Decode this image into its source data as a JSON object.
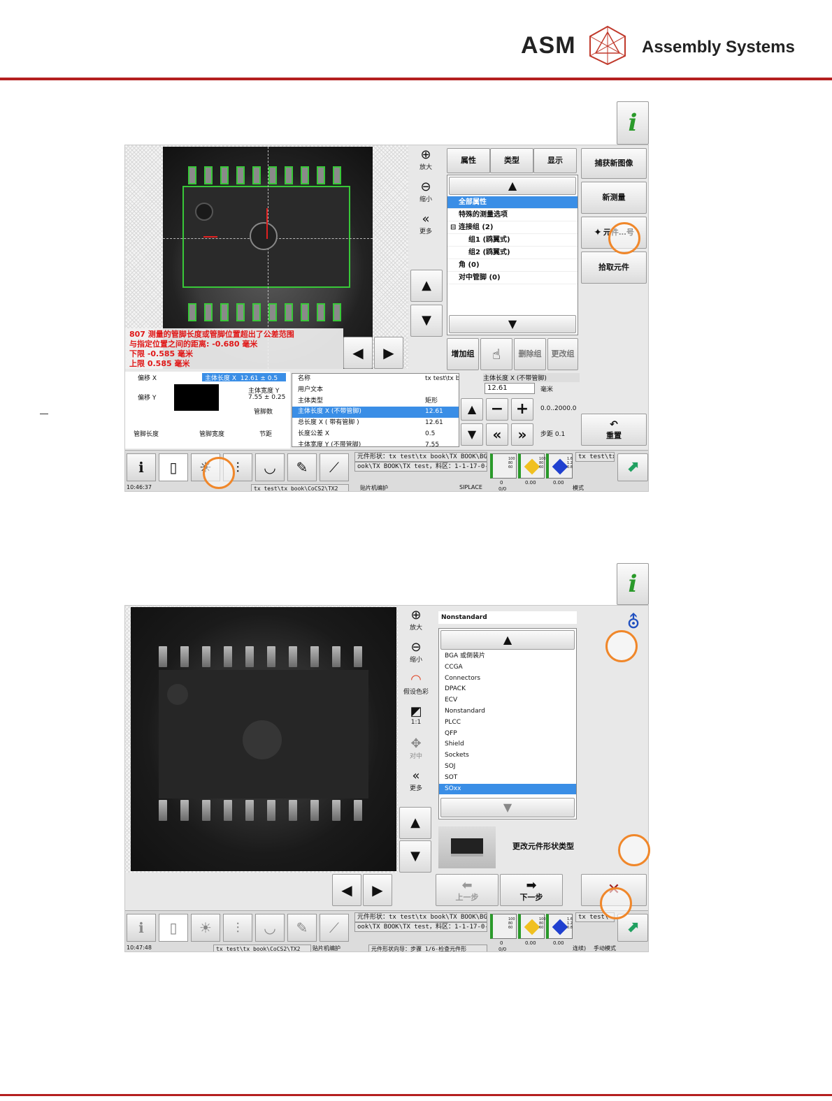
{
  "header": {
    "brand": "ASM",
    "brand_sub": "Assembly Systems"
  },
  "screen1": {
    "view_tools": {
      "zoom_in": "放大",
      "zoom_out": "缩小",
      "more": "更多"
    },
    "tabs": [
      "属性",
      "类型",
      "显示"
    ],
    "props_tree": [
      {
        "label": "全部属性",
        "selected": true
      },
      {
        "label": "特殊的测量选项"
      },
      {
        "label": "连接组 (2)",
        "toggle": "⊟"
      },
      {
        "label": "组1 (鸥翼式)",
        "indent": true
      },
      {
        "label": "组2 (鸥翼式)",
        "indent": true
      },
      {
        "label": "角 (0)"
      },
      {
        "label": "对中管脚 (0)"
      }
    ],
    "side_buttons": {
      "capture": "捕获新图像",
      "new_measure": "新测量",
      "component": "元件…号",
      "pick": "拾取元件"
    },
    "group_buttons": {
      "add": "增加组",
      "delete": "删除组",
      "change": "更改组"
    },
    "error": {
      "line1": "807 测量的管脚长度或管脚位置超出了公差范围",
      "line2": "与指定位置之间的距离: -0.680 毫米",
      "line3": "下限 -0.585 毫米",
      "line4": "上限 0.585 毫米"
    },
    "diagram": {
      "offset_x": "偏移 X",
      "offset_y": "偏移 Y",
      "body_len_x": "主体长度 X",
      "body_len_x_val": "12.61 ± 0.5",
      "body_w_y": "主体宽度 Y",
      "body_w_y_val": "7.55 ± 0.25",
      "pin_count": "管脚数",
      "pin_len": "管脚长度",
      "pin_width": "管脚宽度",
      "pitch": "节距"
    },
    "prop_table": [
      {
        "name": "名称",
        "value": "tx test\\tx b"
      },
      {
        "name": "用户文本",
        "value": ""
      },
      {
        "name": "主体类型",
        "value": "矩形"
      },
      {
        "name": "主体长度 X (不带管脚)",
        "value": "12.61",
        "selected": true
      },
      {
        "name": "总长度 X ( 带有管脚 )",
        "value": "12.61"
      },
      {
        "name": "长度公差 X",
        "value": "0.5"
      },
      {
        "name": "主体宽度 Y (不带管脚)",
        "value": "7.55"
      }
    ],
    "editor": {
      "title": "主体长度 X (不带管脚)",
      "value": "12.61",
      "unit": "毫米",
      "range": "0.0..2000.0",
      "step": "步距 0.1",
      "reset": "重置"
    },
    "status_msg1": "元件形状：tx test\\tx book\\TX BOOK\\BGA",
    "status_msg2": "ook\\TX BOOK\\TX test，料区：1-1-17-0-1",
    "status_right": "tx test\\tx b",
    "clock": "10:46:37",
    "path": "tx test\\tx book\\CoCS2\\TX2",
    "machine": "贴片机编护",
    "siplace": "SIPLACE",
    "mode": "模式",
    "gauges": {
      "v1": "100 80 60",
      "v2": "100 80 60",
      "v3": "1.6 1.2 0.8",
      "n1": "0",
      "n2": "0.00",
      "n3": "0.00",
      "frac": "0/0"
    }
  },
  "screen2": {
    "view_tools": {
      "zoom_in": "放大",
      "zoom_out": "缩小",
      "color": "假设色彩",
      "one_to_one": "1:1",
      "center": "对中",
      "more": "更多"
    },
    "type_title": "Nonstandard",
    "types": [
      "BGA 或倒装片",
      "CCGA",
      "Connectors",
      "DPACK",
      "ECV",
      "Nonstandard",
      "PLCC",
      "QFP",
      "Shield",
      "Sockets",
      "SOJ",
      "SOT",
      "SOxx"
    ],
    "selected_type": "SOxx",
    "change_btn": "更改元件形状类型",
    "prev": "上一步",
    "next": "下一步",
    "status_msg1": "元件形状：tx test\\tx book\\TX BOOK\\BGA",
    "status_msg2": "ook\\TX BOOK\\TX test，料区：1-1-17-0-1",
    "status_right": "tx test\\",
    "clock": "10:47:48",
    "path": "tx test\\tx book\\CoCS2\\TX2",
    "machine": "贴片机编护",
    "wizard": "元件形状向导：步骤 1/6-检查元件形",
    "mode": "连续)",
    "manual": "手动模式"
  },
  "colors": {
    "accent": "#b41f1f",
    "select": "#3a8ee6",
    "annot": "#f0872a",
    "pin_ok": "#38c838"
  }
}
